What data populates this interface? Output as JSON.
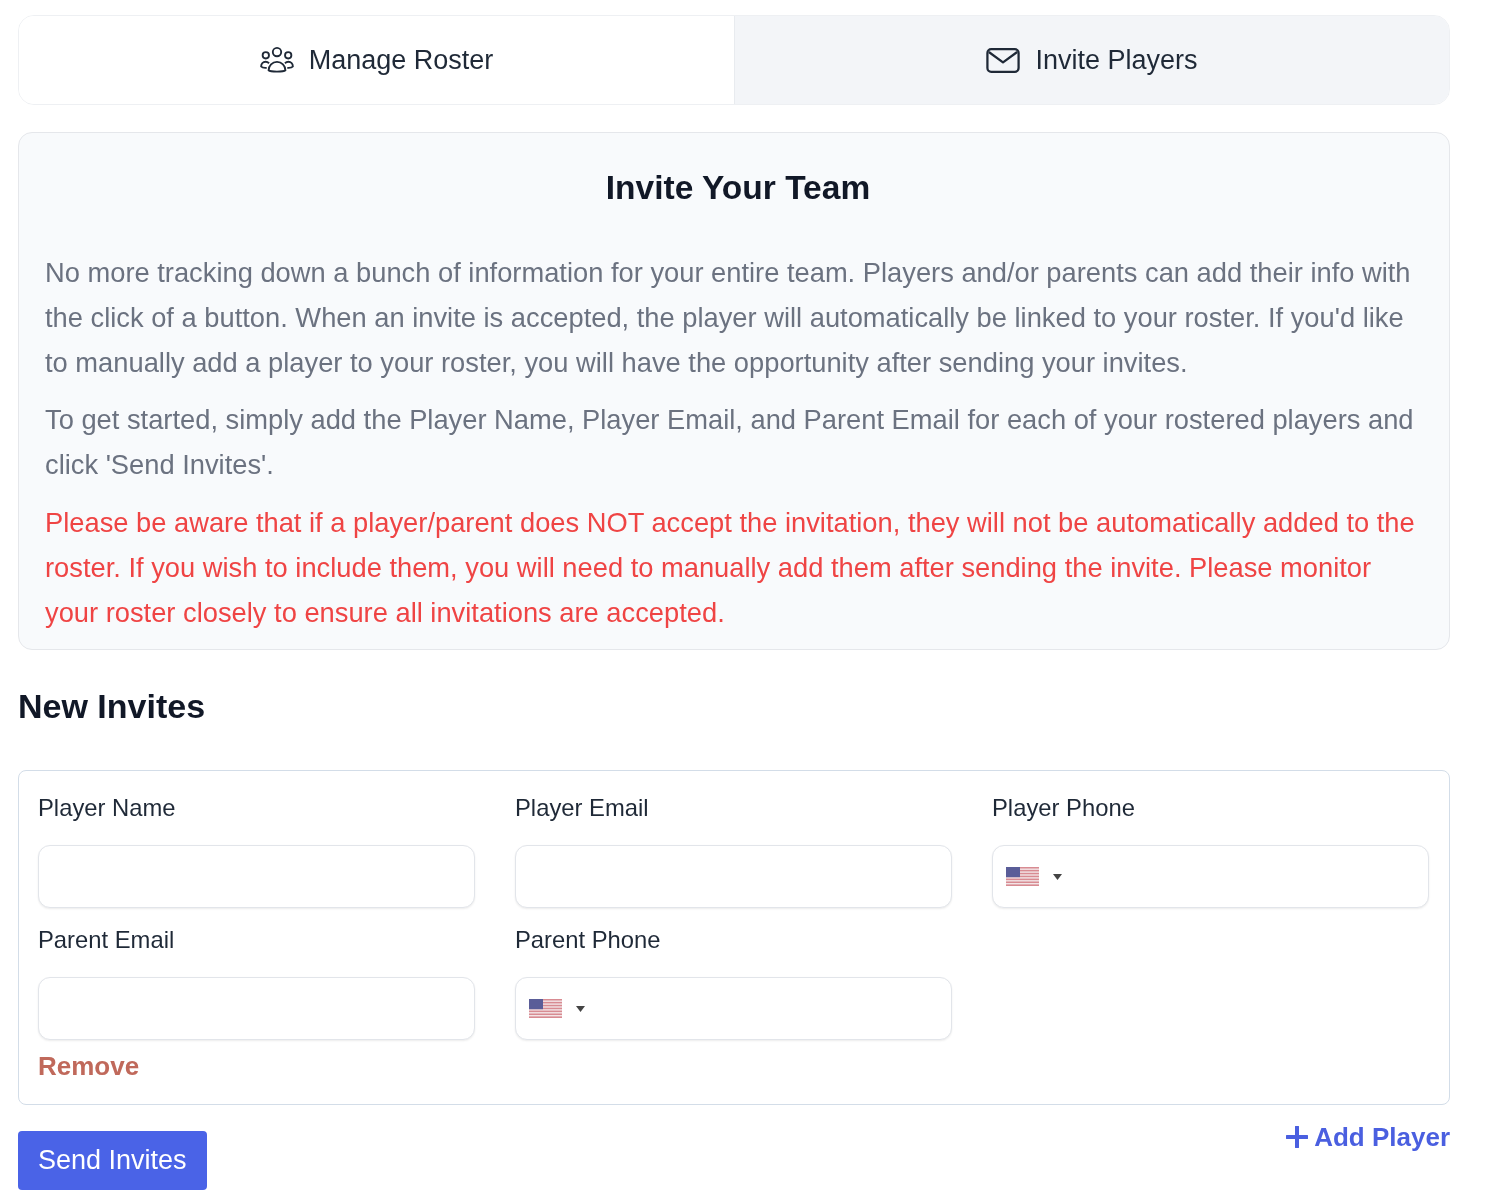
{
  "tabs": [
    {
      "label": "Manage Roster",
      "selected": false
    },
    {
      "label": "Invite Players",
      "selected": true
    }
  ],
  "info_card": {
    "title": "Invite Your Team",
    "paragraphs": [
      {
        "kind": "note",
        "text": "No more tracking down a bunch of information for your entire team. Players and/or parents can add their info with the click of a button. When an invite is accepted, the player will automatically be linked to your roster. If you'd like to manually add a player to your roster, you will have the opportunity after sending your invites."
      },
      {
        "kind": "note",
        "text": "To get started, simply add the Player Name, Player Email, and Parent Email for each of your rostered players and click 'Send Invites'."
      },
      {
        "kind": "warning",
        "text": "Please be aware that if a player/parent does NOT accept the invitation, they will not be automatically added to the roster. If you wish to include them, you will need to manually add them after sending the invite. Please monitor your roster closely to ensure all invitations are accepted."
      }
    ]
  },
  "new_invites": {
    "title": "New Invites",
    "invites": [
      {
        "fields": [
          {
            "label": "Player Name",
            "kind": "text"
          },
          {
            "label": "Player Email",
            "kind": "text"
          },
          {
            "label": "Player Phone",
            "kind": "phone"
          },
          {
            "label": "Parent Email",
            "kind": "text"
          },
          {
            "label": "Parent Phone",
            "kind": "phone"
          }
        ],
        "remove_link": "Remove"
      }
    ]
  },
  "actions": {
    "send_button": "Send Invites",
    "add_player_link": "Add Player"
  }
}
